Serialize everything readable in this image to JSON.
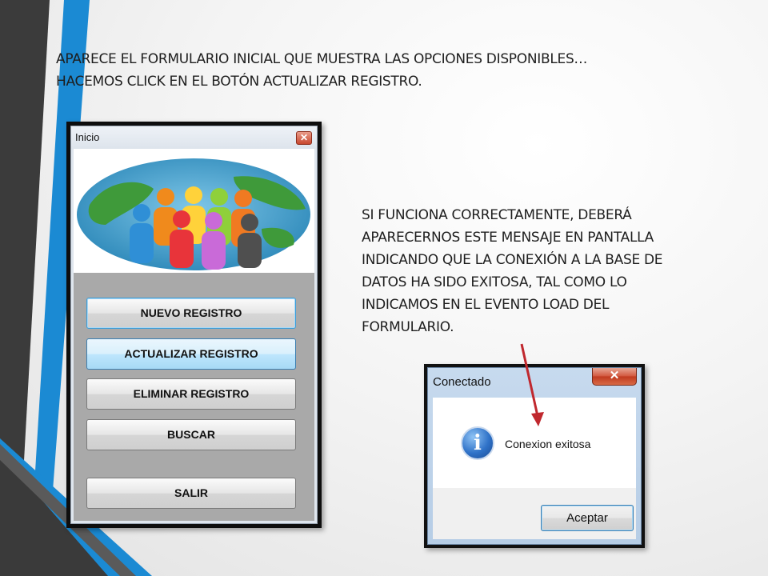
{
  "slide": {
    "intro_line1": "APARECE EL FORMULARIO INICIAL QUE MUESTRA LAS OPCIONES DISPONIBLES…",
    "intro_line2": "HACEMOS CLICK EN EL BOTÓN ACTUALIZAR REGISTRO.",
    "explanation_lines": [
      "SI FUNCIONA CORRECTAMENTE,  DEBERÁ",
      "APARECERNOS ESTE MENSAJE EN PANTALLA",
      "INDICANDO QUE LA CONEXIÓN A LA BASE DE",
      "DATOS HA SIDO EXITOSA, TAL COMO LO",
      "INDICAMOS EN EL EVENTO LOAD DEL",
      "FORMULARIO."
    ]
  },
  "inicio_window": {
    "title": "Inicio",
    "close_glyph": "✕",
    "buttons": {
      "nuevo": "NUEVO REGISTRO",
      "actualizar": "ACTUALIZAR REGISTRO",
      "eliminar": "ELIMINAR REGISTRO",
      "buscar": "BUSCAR",
      "salir": "SALIR"
    }
  },
  "message_box": {
    "title": "Conectado",
    "close_glyph": "✕",
    "icon": "info-icon",
    "icon_glyph": "i",
    "message": "Conexion exitosa",
    "ok_label": "Aceptar"
  },
  "colors": {
    "accent_blue": "#1b8ad3",
    "dark_stripe": "#3a3a3a",
    "arrow_red": "#c0282e"
  }
}
